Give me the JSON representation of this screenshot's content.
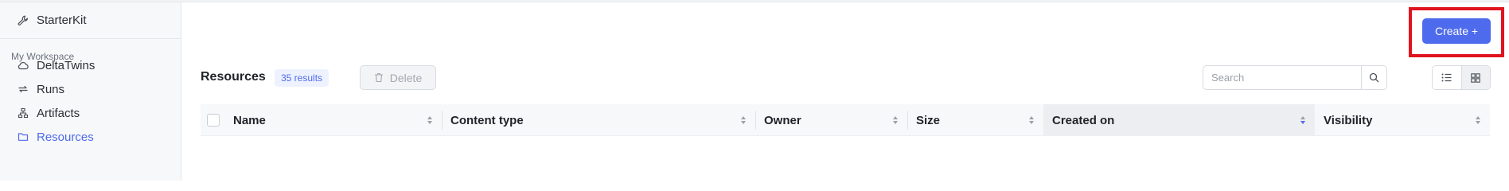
{
  "sidebar": {
    "brand": {
      "label": "StarterKit",
      "icon": "wrench-icon"
    },
    "section_label": "My Workspace",
    "items": [
      {
        "label": "DeltaTwins",
        "icon": "cloud-icon",
        "active": false
      },
      {
        "label": "Runs",
        "icon": "repeat-icon",
        "active": false
      },
      {
        "label": "Artifacts",
        "icon": "hierarchy-icon",
        "active": false
      },
      {
        "label": "Resources",
        "icon": "folder-icon",
        "active": true
      }
    ]
  },
  "header": {
    "create_label": "Create +"
  },
  "resources": {
    "title": "Resources",
    "results_badge": "35 results",
    "delete_label": "Delete",
    "search_placeholder": "Search",
    "search_value": ""
  },
  "table": {
    "columns": [
      {
        "label": "Name",
        "sorted": false
      },
      {
        "label": "Content type",
        "sorted": false
      },
      {
        "label": "Owner",
        "sorted": false
      },
      {
        "label": "Size",
        "sorted": false
      },
      {
        "label": "Created on",
        "sorted": true,
        "direction": "desc"
      },
      {
        "label": "Visibility",
        "sorted": false
      }
    ]
  },
  "colors": {
    "accent": "#4f6bed",
    "highlight_border": "#e0141e"
  }
}
